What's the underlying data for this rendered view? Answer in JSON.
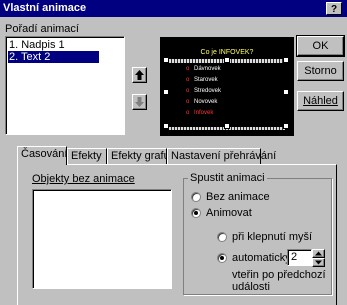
{
  "window": {
    "title": "Vlastní animace",
    "help_label": "?"
  },
  "order": {
    "label": "Pořadí animací",
    "items": [
      {
        "label": "1. Nadpis 1",
        "selected": false
      },
      {
        "label": "2. Text 2",
        "selected": true
      }
    ],
    "move_up_icon": "arrow-up-icon",
    "move_down_icon": "arrow-down-icon"
  },
  "preview": {
    "title": "Co je INFOVEK?",
    "lines": [
      "Dávnovek",
      "Starovek",
      "Stredovek",
      "Novovek",
      "Infovek"
    ],
    "highlight_color": "#ff3333"
  },
  "buttons": {
    "ok": "OK",
    "cancel": "Storno",
    "preview": "Náhled"
  },
  "tabs": [
    "Časování",
    "Efekty",
    "Efekty grafu",
    "Nastavení přehrávání"
  ],
  "timing": {
    "objects_label": "Objekty bez animace",
    "start_group_label": "Spustit animaci",
    "no_animation": "Bez animace",
    "animate": "Animovat",
    "on_click": "při klepnutí myší",
    "automatic": "automaticky",
    "seconds_value": "2",
    "seconds_after": "vteřin po předchozí",
    "seconds_after_2": "události"
  }
}
